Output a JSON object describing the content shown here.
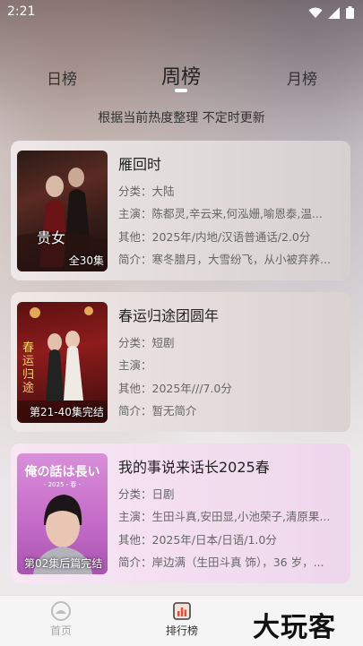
{
  "status": {
    "time": "2:21"
  },
  "tabs": {
    "left": "日榜",
    "center": "周榜",
    "right": "月榜"
  },
  "subtitle": "根据当前热度整理 不定时更新",
  "cards": [
    {
      "title": "雁回时",
      "poster_text": "贵女",
      "poster_label": "全30集",
      "category": "分类：大陆",
      "cast": "主演：陈都灵,辛云来,何泓姗,喻恩泰,温...",
      "other": "其他：2025年/内地/汉语普通话/2.0分",
      "intro": "简介：寒冬腊月，大雪纷飞，从小被弃养..."
    },
    {
      "title": "春运归途团圆年",
      "poster_text": "春运归途",
      "poster_label": "第21-40集完结",
      "category": "分类：短剧",
      "cast": "主演：",
      "other": "其他：2025年///7.0分",
      "intro": "简介：暂无简介"
    },
    {
      "title": "我的事说来话长2025春",
      "poster_text": "俺の話は長い",
      "poster_subtext": "- 2025・春 -",
      "poster_label": "第02集后篇完结",
      "category": "分类：日剧",
      "cast": "主演：生田斗真,安田显,小池荣子,清原果...",
      "other": "其他：2025年/日本/日语/1.0分",
      "intro": "简介：岸边满（生田斗真 饰），36 岁，..."
    }
  ],
  "nav": {
    "home": "首页",
    "rank": "排行榜"
  },
  "watermark": "大玩客"
}
